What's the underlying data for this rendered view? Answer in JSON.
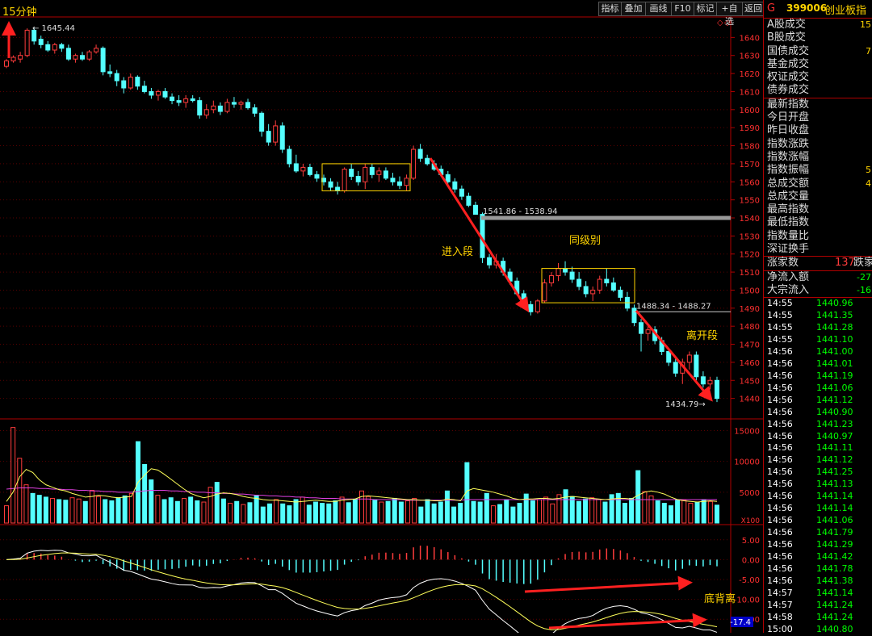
{
  "toolbar": {
    "period": "15分钟",
    "buttons": [
      "指标",
      "叠加",
      "画线",
      "F10",
      "标记",
      "+自选",
      "返回"
    ]
  },
  "security": {
    "marker": "G",
    "code": "399006",
    "name": "创业板指"
  },
  "info_panel": {
    "rows": [
      {
        "label": "A股成交",
        "value": "15"
      },
      {
        "label": "B股成交",
        "value": ""
      },
      {
        "label": "国债成交",
        "value": "7"
      },
      {
        "label": "基金成交",
        "value": ""
      },
      {
        "label": "权证成交",
        "value": ""
      },
      {
        "label": "债券成交",
        "value": ""
      }
    ],
    "index_rows": [
      {
        "label": "最新指数",
        "value": ""
      },
      {
        "label": "今日开盘",
        "value": ""
      },
      {
        "label": "昨日收盘",
        "value": ""
      },
      {
        "label": "指数涨跌",
        "value": ""
      },
      {
        "label": "指数涨幅",
        "value": ""
      },
      {
        "label": "指数振幅",
        "value": "5"
      },
      {
        "label": "总成交额",
        "value": "4"
      },
      {
        "label": "总成交量",
        "value": ""
      },
      {
        "label": "最高指数",
        "value": ""
      },
      {
        "label": "最低指数",
        "value": ""
      },
      {
        "label": "指数量比",
        "value": ""
      },
      {
        "label": "深证换手",
        "value": ""
      }
    ],
    "breadth": {
      "up_label": "涨家数",
      "up_value": "137",
      "down_label": "跌家数"
    },
    "flow_rows": [
      {
        "label": "净流入额",
        "value": "-27"
      },
      {
        "label": "大宗流入",
        "value": "-16"
      }
    ]
  },
  "ticks": [
    {
      "time": "14:55",
      "price": "1440.96"
    },
    {
      "time": "14:55",
      "price": "1441.35"
    },
    {
      "time": "14:55",
      "price": "1441.28"
    },
    {
      "time": "14:55",
      "price": "1441.10"
    },
    {
      "time": "14:56",
      "price": "1441.00"
    },
    {
      "time": "14:56",
      "price": "1441.01"
    },
    {
      "time": "14:56",
      "price": "1441.19"
    },
    {
      "time": "14:56",
      "price": "1441.06"
    },
    {
      "time": "14:56",
      "price": "1441.12"
    },
    {
      "time": "14:56",
      "price": "1440.90"
    },
    {
      "time": "14:56",
      "price": "1441.23"
    },
    {
      "time": "14:56",
      "price": "1440.97"
    },
    {
      "time": "14:56",
      "price": "1441.11"
    },
    {
      "time": "14:56",
      "price": "1441.12"
    },
    {
      "time": "14:56",
      "price": "1441.25"
    },
    {
      "time": "14:56",
      "price": "1441.13"
    },
    {
      "time": "14:56",
      "price": "1441.14"
    },
    {
      "time": "14:56",
      "price": "1441.14"
    },
    {
      "time": "14:56",
      "price": "1441.06"
    },
    {
      "time": "14:56",
      "price": "1441.79"
    },
    {
      "time": "14:56",
      "price": "1441.29"
    },
    {
      "time": "14:56",
      "price": "1441.42"
    },
    {
      "time": "14:56",
      "price": "1441.78"
    },
    {
      "time": "14:56",
      "price": "1441.38"
    },
    {
      "time": "14:57",
      "price": "1441.14"
    },
    {
      "time": "14:57",
      "price": "1441.24"
    },
    {
      "time": "14:58",
      "price": "1441.24"
    },
    {
      "time": "15:00",
      "price": "1440.80"
    }
  ],
  "colors": {
    "up": "#ff3c3c",
    "down": "#54ffff",
    "axis": "#b00000",
    "grid": "#5a0000",
    "label": "#ff3030",
    "annotation": "#ffd400",
    "arrow": "#ff2020",
    "ma_yellow": "#ffff5a",
    "ma_magenta": "#e040e0"
  },
  "chart_data": [
    {
      "type": "candlestick",
      "yticks": [
        1440,
        1450,
        1460,
        1470,
        1480,
        1490,
        1500,
        1510,
        1520,
        1530,
        1540,
        1550,
        1560,
        1570,
        1580,
        1590,
        1600,
        1610,
        1620,
        1630,
        1640
      ],
      "ylim": [
        1430,
        1650
      ],
      "hline": 1540,
      "hline2": 1488,
      "candles": [
        [
          1624,
          1628,
          1623,
          1627
        ],
        [
          1627,
          1630,
          1626,
          1629
        ],
        [
          1628,
          1632,
          1626,
          1630
        ],
        [
          1630,
          1645,
          1629,
          1644
        ],
        [
          1644,
          1645.44,
          1636,
          1638
        ],
        [
          1639,
          1641,
          1634,
          1636
        ],
        [
          1636,
          1638,
          1632,
          1633
        ],
        [
          1633,
          1637,
          1631,
          1636
        ],
        [
          1636,
          1637,
          1632,
          1634
        ],
        [
          1634,
          1636,
          1627,
          1628
        ],
        [
          1628,
          1631,
          1626,
          1630
        ],
        [
          1630,
          1632,
          1627,
          1628
        ],
        [
          1628,
          1633,
          1627,
          1632
        ],
        [
          1632,
          1636,
          1631,
          1634
        ],
        [
          1634,
          1635,
          1619,
          1621
        ],
        [
          1621,
          1625,
          1618,
          1620
        ],
        [
          1620,
          1622,
          1613,
          1616
        ],
        [
          1616,
          1618,
          1609,
          1612
        ],
        [
          1612,
          1620,
          1611,
          1618
        ],
        [
          1618,
          1619,
          1611,
          1613
        ],
        [
          1613,
          1616,
          1609,
          1610
        ],
        [
          1610,
          1612,
          1606,
          1608
        ],
        [
          1608,
          1611,
          1605,
          1610
        ],
        [
          1610,
          1612,
          1606,
          1607
        ],
        [
          1607,
          1609,
          1603,
          1605
        ],
        [
          1605,
          1608,
          1602,
          1604
        ],
        [
          1604,
          1608,
          1601,
          1606
        ],
        [
          1606,
          1608,
          1604,
          1605
        ],
        [
          1605,
          1607,
          1595,
          1597
        ],
        [
          1597,
          1603,
          1595,
          1600
        ],
        [
          1600,
          1605,
          1598,
          1602
        ],
        [
          1602,
          1604,
          1597,
          1599
        ],
        [
          1599,
          1606,
          1598,
          1604
        ],
        [
          1604,
          1607,
          1601,
          1603
        ],
        [
          1603,
          1605,
          1600,
          1604
        ],
        [
          1604,
          1606,
          1600,
          1601
        ],
        [
          1601,
          1603,
          1596,
          1598
        ],
        [
          1598,
          1599,
          1585,
          1588
        ],
        [
          1588,
          1592,
          1580,
          1582
        ],
        [
          1582,
          1594,
          1580,
          1591
        ],
        [
          1591,
          1593,
          1576,
          1578
        ],
        [
          1578,
          1580,
          1568,
          1570
        ],
        [
          1570,
          1575,
          1565,
          1566
        ],
        [
          1566,
          1570,
          1563,
          1568
        ],
        [
          1568,
          1570,
          1563,
          1564
        ],
        [
          1564,
          1566,
          1560,
          1562
        ],
        [
          1562,
          1564,
          1558,
          1560
        ],
        [
          1560,
          1562,
          1555,
          1557
        ],
        [
          1557,
          1560,
          1553,
          1555
        ],
        [
          1555,
          1568,
          1554,
          1567
        ],
        [
          1567,
          1570,
          1561,
          1563
        ],
        [
          1563,
          1566,
          1558,
          1560
        ],
        [
          1560,
          1570,
          1556,
          1568
        ],
        [
          1568,
          1570,
          1562,
          1564
        ],
        [
          1564,
          1568,
          1560,
          1566
        ],
        [
          1566,
          1568,
          1561,
          1562
        ],
        [
          1562,
          1565,
          1558,
          1560
        ],
        [
          1560,
          1563,
          1556,
          1558
        ],
        [
          1558,
          1564,
          1555,
          1562
        ],
        [
          1562,
          1580,
          1561,
          1578
        ],
        [
          1578,
          1581,
          1571,
          1573
        ],
        [
          1573,
          1575,
          1569,
          1570
        ],
        [
          1570,
          1572,
          1566,
          1567
        ],
        [
          1567,
          1569,
          1563,
          1564
        ],
        [
          1564,
          1566,
          1559,
          1560
        ],
        [
          1560,
          1562,
          1554,
          1556
        ],
        [
          1556,
          1558,
          1550,
          1552
        ],
        [
          1552,
          1554,
          1546,
          1547
        ],
        [
          1547,
          1549,
          1541.86,
          1542
        ],
        [
          1542,
          1543,
          1515,
          1518
        ],
        [
          1518,
          1520,
          1512,
          1514
        ],
        [
          1514,
          1520,
          1512,
          1516
        ],
        [
          1516,
          1518,
          1508,
          1510
        ],
        [
          1510,
          1512,
          1503,
          1505
        ],
        [
          1505,
          1507,
          1497,
          1498
        ],
        [
          1498,
          1500,
          1490,
          1492
        ],
        [
          1492,
          1494,
          1486,
          1488
        ],
        [
          1488,
          1495,
          1487,
          1494
        ],
        [
          1494,
          1506,
          1493,
          1504
        ],
        [
          1504,
          1510,
          1502,
          1508
        ],
        [
          1508,
          1515,
          1505,
          1512
        ],
        [
          1512,
          1516,
          1508,
          1510
        ],
        [
          1510,
          1513,
          1504,
          1506
        ],
        [
          1506,
          1510,
          1500,
          1502
        ],
        [
          1502,
          1505,
          1496,
          1498
        ],
        [
          1498,
          1502,
          1494,
          1500
        ],
        [
          1500,
          1508,
          1498,
          1506
        ],
        [
          1506,
          1512,
          1502,
          1504
        ],
        [
          1504,
          1507,
          1499,
          1500
        ],
        [
          1500,
          1502,
          1494,
          1496
        ],
        [
          1496,
          1499,
          1488.34,
          1490
        ],
        [
          1490,
          1492,
          1480,
          1482
        ],
        [
          1482,
          1484,
          1466,
          1476
        ],
        [
          1476,
          1480,
          1472,
          1478
        ],
        [
          1478,
          1480,
          1470,
          1472
        ],
        [
          1472,
          1474,
          1464,
          1466
        ],
        [
          1466,
          1468,
          1458,
          1460
        ],
        [
          1460,
          1462,
          1452,
          1454
        ],
        [
          1454,
          1462,
          1448,
          1460
        ],
        [
          1460,
          1466,
          1456,
          1464
        ],
        [
          1464,
          1466,
          1450,
          1452
        ],
        [
          1452,
          1455,
          1446,
          1448
        ],
        [
          1448,
          1452,
          1445,
          1450
        ],
        [
          1450,
          1452,
          1438,
          1440
        ]
      ]
    },
    {
      "type": "bar",
      "yticks": [
        5000,
        10000,
        15000
      ],
      "ylim": [
        0,
        16500
      ],
      "unit_label": "X100",
      "volumes": [
        2800,
        15500,
        10500,
        6200,
        4800,
        4500,
        4200,
        4000,
        3800,
        3700,
        4100,
        3900,
        3500,
        5300,
        4300,
        3800,
        3600,
        4100,
        4400,
        4800,
        13200,
        9500,
        7000,
        4500,
        3800,
        4100,
        3500,
        4000,
        4200,
        3600,
        3400,
        5800,
        6600,
        3900,
        3200,
        3500,
        3000,
        3300,
        4500,
        2600,
        3100,
        3800,
        3100,
        2800,
        3800,
        4200,
        2900,
        3400,
        3200,
        3100,
        3600,
        4200,
        3300,
        3800,
        5200,
        4300,
        3700,
        3400,
        3500,
        4000,
        3400,
        3600,
        4000,
        2600,
        3800,
        3100,
        3400,
        5200,
        2600,
        3200,
        9800,
        3500,
        3400,
        4800,
        2800,
        3000,
        3800,
        2600,
        3200,
        4700,
        3600,
        3800,
        4200,
        3100,
        4600,
        5400,
        4300,
        3500,
        3900,
        4100,
        3800,
        3400,
        4600,
        4800,
        3200,
        4000,
        8500,
        5100,
        4400,
        3600,
        3200,
        2800,
        3800,
        3700,
        3200,
        3400,
        3800,
        3500,
        2900
      ],
      "ma_yellow": [
        3500,
        5000,
        7500,
        8700,
        8200,
        7000,
        6200,
        5800,
        5400,
        5200,
        4800,
        4500,
        4200,
        4300,
        4500,
        4400,
        4200,
        4100,
        4200,
        4300,
        6600,
        7800,
        8800,
        8600,
        7900,
        7100,
        6300,
        5500,
        4800,
        4400,
        4100,
        4300,
        4700,
        4900,
        4800,
        4600,
        4300,
        4100,
        4000,
        3800,
        3700,
        3700,
        3600,
        3500,
        3400,
        3500,
        3600,
        3700,
        3600,
        3500,
        3500,
        3700,
        3800,
        3900,
        4300,
        4400,
        4300,
        4200,
        4100,
        4000,
        3900,
        3800,
        3800,
        3700,
        3700,
        3600,
        3600,
        3900,
        3800,
        3600,
        5200,
        5600,
        5400,
        5200,
        5000,
        4700,
        4400,
        4000,
        3800,
        3900,
        3900,
        4000,
        4000,
        3900,
        4000,
        4200,
        4300,
        4200,
        4100,
        4000,
        3900,
        3800,
        3900,
        4000,
        4000,
        3900,
        4500,
        5000,
        5200,
        5000,
        4700,
        4200,
        3800,
        3600,
        3500,
        3400,
        3500,
        3600,
        3500
      ],
      "ma_magenta": [
        5500,
        5600,
        5700,
        5700,
        5700,
        5600,
        5600,
        5500,
        5500,
        5400,
        5400,
        5300,
        5300,
        5200,
        5200,
        5100,
        5100,
        5000,
        5000,
        5000,
        5100,
        5200,
        5300,
        5300,
        5300,
        5200,
        5200,
        5100,
        5100,
        5000,
        5000,
        4900,
        4900,
        4800,
        4800,
        4700,
        4700,
        4600,
        4500,
        4500,
        4400,
        4400,
        4300,
        4300,
        4200,
        4200,
        4100,
        4100,
        4000,
        4000,
        4000,
        3900,
        3900,
        3900,
        3900,
        3900,
        3800,
        3800,
        3800,
        3800,
        3800,
        3700,
        3700,
        3700,
        3700,
        3700,
        3700,
        3700,
        3700,
        3700,
        3800,
        3800,
        3800,
        3800,
        3800,
        3800,
        3800,
        3800,
        3800,
        3800,
        3800,
        3800,
        3800,
        3800,
        3800,
        3800,
        3800,
        3800,
        3800,
        3800,
        3800,
        3800,
        3800,
        3800,
        3800,
        3800,
        3800,
        3800,
        3800,
        3800,
        3800,
        3800,
        3800,
        3800,
        3800,
        3800,
        3800,
        3800,
        3800
      ]
    },
    {
      "type": "macd",
      "yticks": [
        5.0,
        0.0,
        -5.0,
        -10.0,
        -15.0
      ],
      "ylim": [
        -18,
        8
      ],
      "last_value": "-17.4"
    }
  ],
  "annotations": {
    "high_label": "1645.44",
    "range1_label": "1541.86 - 1538.94",
    "range2_label": "1488.34 - 1488.27",
    "low_label": "1434.79",
    "entry_segment": "进入段",
    "same_level": "同级别",
    "exit_segment": "离开段",
    "divergence": "底背离"
  }
}
